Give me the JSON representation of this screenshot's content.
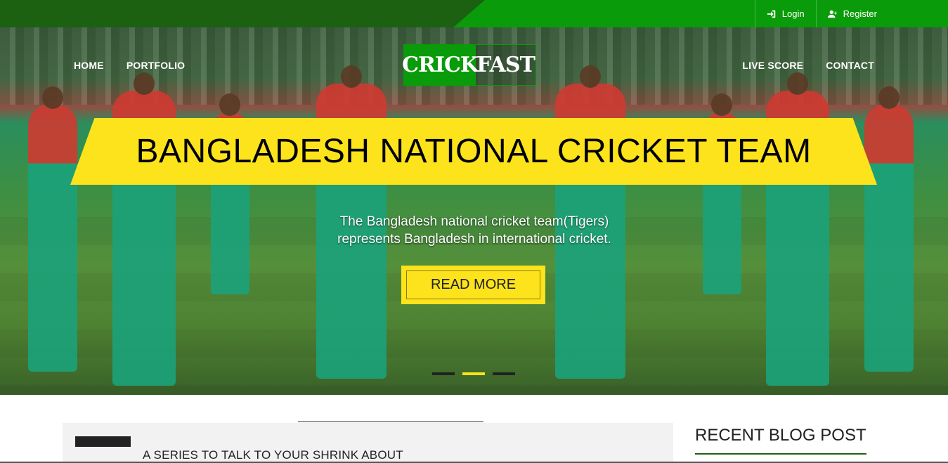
{
  "topbar": {
    "login_label": "Login",
    "register_label": "Register"
  },
  "nav": {
    "left": [
      "HOME",
      "PORTFOLIO"
    ],
    "right": [
      "LIVE SCORE",
      "CONTACT"
    ]
  },
  "logo": {
    "part1": "CRICK",
    "part2": "FAST"
  },
  "hero": {
    "headline": "BANGLADESH NATIONAL CRICKET TEAM",
    "caption_line1": "The Bangladesh national cricket team(Tigers)",
    "caption_line2": "represents Bangladesh in international cricket.",
    "button_label": "READ MORE",
    "slides": 3,
    "active_slide": 2
  },
  "main": {
    "post_title": "A SERIES TO TALK TO YOUR SHRINK ABOUT"
  },
  "sidebar": {
    "title": "RECENT BLOG POST"
  },
  "colors": {
    "brand_green": "#0a9b0a",
    "dark_green": "#1c6012",
    "accent_yellow": "#fde31c"
  }
}
